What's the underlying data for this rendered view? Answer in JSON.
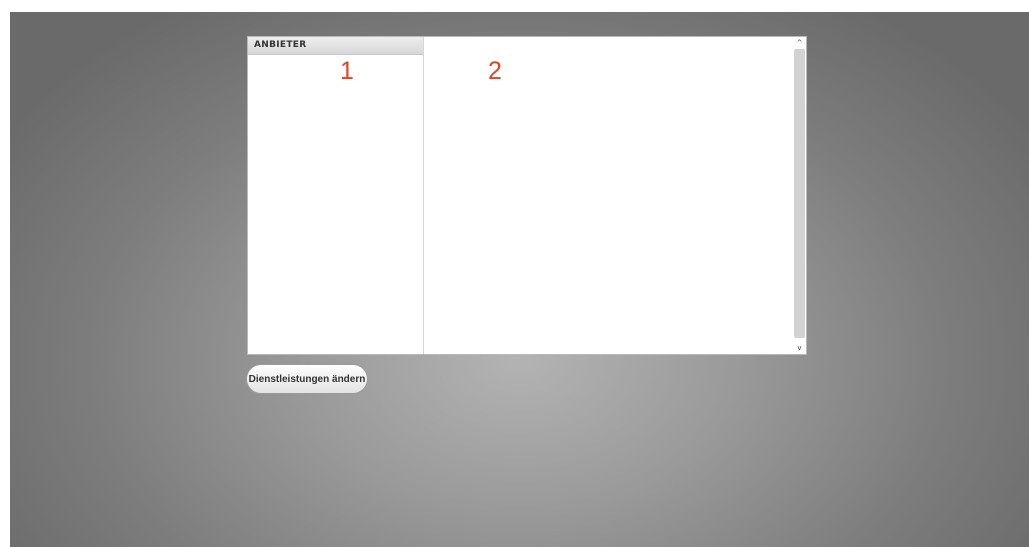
{
  "left_panel": {
    "header": "ANBIETER",
    "marker": "1"
  },
  "right_panel": {
    "marker": "2"
  },
  "scrollbar": {
    "up_icon": "chevron-up-icon",
    "down_icon": "chevron-down-icon",
    "up_glyph": "^",
    "down_glyph": "v"
  },
  "actions": {
    "change_services_label": "Dienstleistungen ändern"
  },
  "colors": {
    "marker": "#e8411f",
    "background": "#9a9a9a"
  }
}
